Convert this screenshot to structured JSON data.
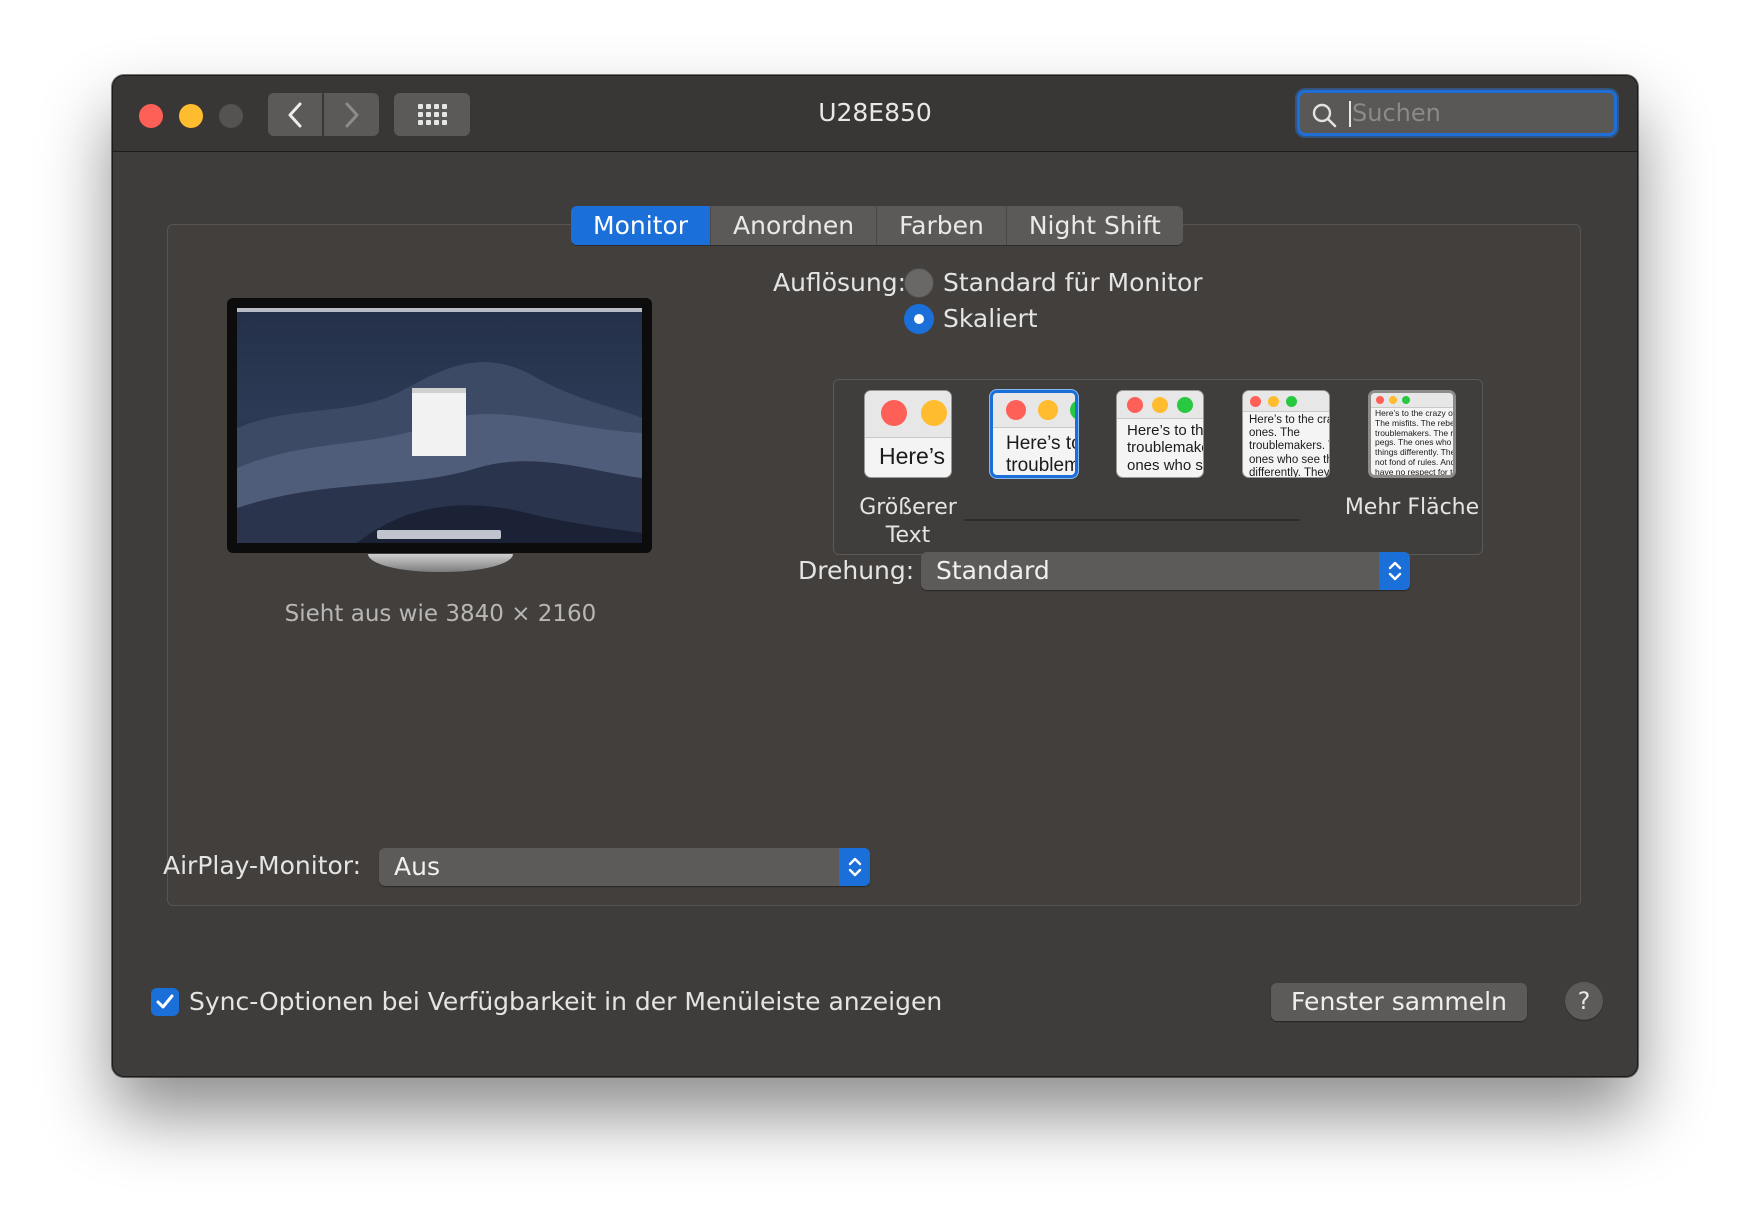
{
  "window": {
    "title": "U28E850"
  },
  "search": {
    "placeholder": "Suchen"
  },
  "tabs": [
    {
      "label": "Monitor",
      "active": true
    },
    {
      "label": "Anordnen",
      "active": false
    },
    {
      "label": "Farben",
      "active": false
    },
    {
      "label": "Night Shift",
      "active": false
    }
  ],
  "monitor": {
    "caption": "Sieht aus wie 3840 × 2160"
  },
  "resolution": {
    "label": "Auflösung:",
    "options": [
      {
        "label": "Standard für Monitor",
        "selected": false
      },
      {
        "label": "Skaliert",
        "selected": true
      }
    ],
    "scale_labels": {
      "left": "Größerer Text",
      "right": "Mehr Fläche"
    },
    "selected_scale_index": 1,
    "previews": [
      "Here’s",
      "Here’s to the troublemakers.",
      "Here’s to the troublemakers. The ones who see",
      "Here’s to the crazy ones. The troublemakers. The ones who see things differently. They are not fond of rules. And they",
      "Here’s to the crazy ones. The misfits. The rebels. The troublemakers. The round pegs. The ones who see things differently. They are not fond of rules. And they have no respect for the status quo. You can quote them, disagree with them. About the only thing you can’t do is ignore them. Because they change things."
    ]
  },
  "rotation": {
    "label": "Drehung:",
    "value": "Standard"
  },
  "airplay": {
    "label": "AirPlay-Monitor:",
    "value": "Aus"
  },
  "sync": {
    "label": "Sync-Optionen bei Verfügbarkeit in der Menüleiste anzeigen",
    "checked": true
  },
  "gather_button": "Fenster sammeln",
  "help_button": "?",
  "colors": {
    "accent": "#1a6fd9",
    "close": "#fe5f57",
    "minimize": "#febc2e",
    "window_bg": "#3f3d3b"
  }
}
